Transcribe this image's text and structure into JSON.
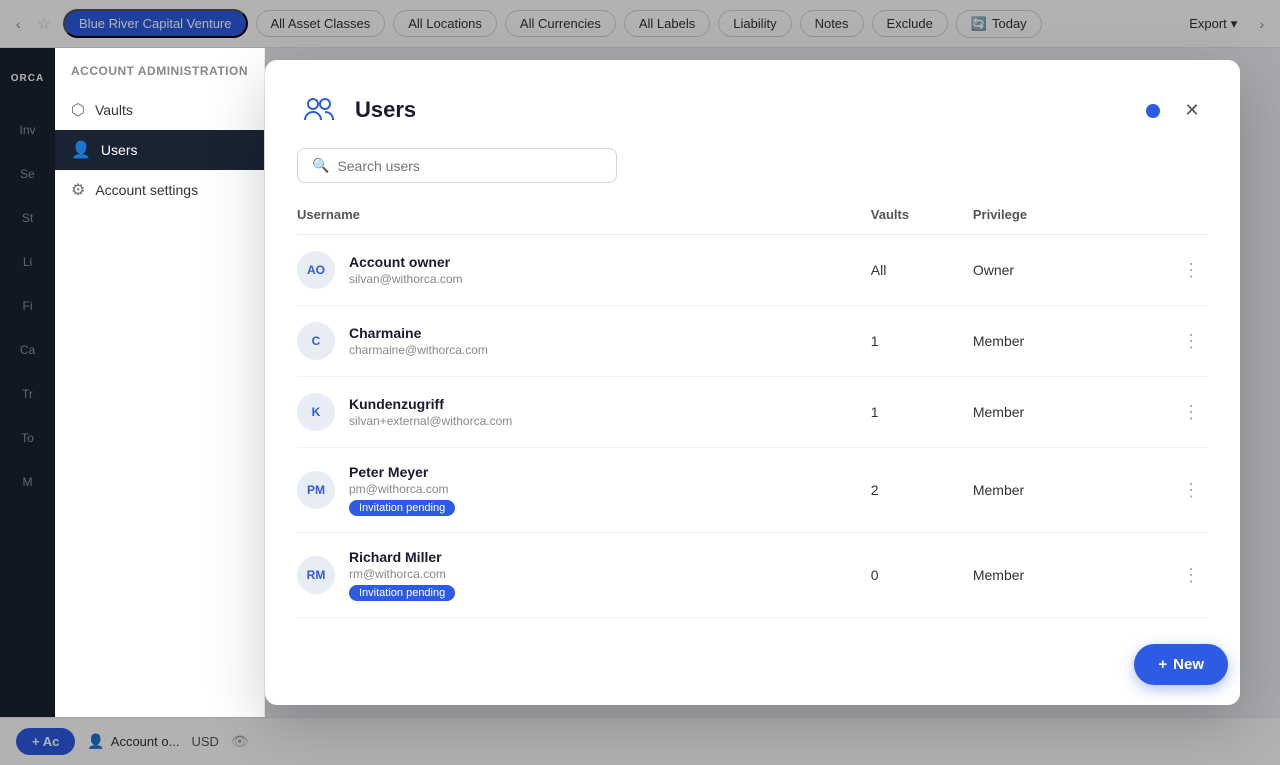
{
  "topnav": {
    "chevron_left": "‹",
    "star": "☆",
    "pills": [
      {
        "label": "Blue River Capital Venture",
        "type": "filled"
      },
      {
        "label": "All Asset Classes",
        "type": "outline"
      },
      {
        "label": "All Locations",
        "type": "outline"
      },
      {
        "label": "All Currencies",
        "type": "outline"
      },
      {
        "label": "All Labels",
        "type": "outline"
      },
      {
        "label": "Liability",
        "type": "outline"
      },
      {
        "label": "Notes",
        "type": "outline"
      },
      {
        "label": "Exclude",
        "type": "outline"
      },
      {
        "label": "Today",
        "type": "outline-icon"
      }
    ],
    "export_label": "Export",
    "chevron_right": "›"
  },
  "sidebar": {
    "logo": "ORCA",
    "icons": [
      "Inv",
      "Se",
      "St",
      "Li",
      "Fi",
      "Ca",
      "Tr",
      "To",
      "M"
    ]
  },
  "admin_panel": {
    "title": "Account administration",
    "items": [
      {
        "label": "Vaults",
        "icon": "⬡",
        "active": false
      },
      {
        "label": "Users",
        "icon": "👤",
        "active": true
      },
      {
        "label": "Account settings",
        "icon": "⚙",
        "active": false
      }
    ]
  },
  "modal": {
    "title": "Users",
    "close_icon": "✕",
    "search_placeholder": "Search users",
    "columns": {
      "username": "Username",
      "vaults": "Vaults",
      "privilege": "Privilege"
    },
    "users": [
      {
        "initials": "AO",
        "name": "Account owner",
        "email": "silvan@withorca.com",
        "vaults": "All",
        "privilege": "Owner",
        "badge": null
      },
      {
        "initials": "C",
        "name": "Charmaine",
        "email": "charmaine@withorca.com",
        "vaults": "1",
        "privilege": "Member",
        "badge": null
      },
      {
        "initials": "K",
        "name": "Kundenzugriff",
        "email": "silvan+external@withorca.com",
        "vaults": "1",
        "privilege": "Member",
        "badge": null
      },
      {
        "initials": "PM",
        "name": "Peter Meyer",
        "email": "pm@withorca.com",
        "vaults": "2",
        "privilege": "Member",
        "badge": "Invitation pending"
      },
      {
        "initials": "RM",
        "name": "Richard Miller",
        "email": "rm@withorca.com",
        "vaults": "0",
        "privilege": "Member",
        "badge": "Invitation pending"
      }
    ]
  },
  "new_button": {
    "label": "New",
    "plus": "+"
  },
  "bottom_bar": {
    "add_label": "+ Ac",
    "account_label": "Account o...",
    "currency": "USD"
  }
}
